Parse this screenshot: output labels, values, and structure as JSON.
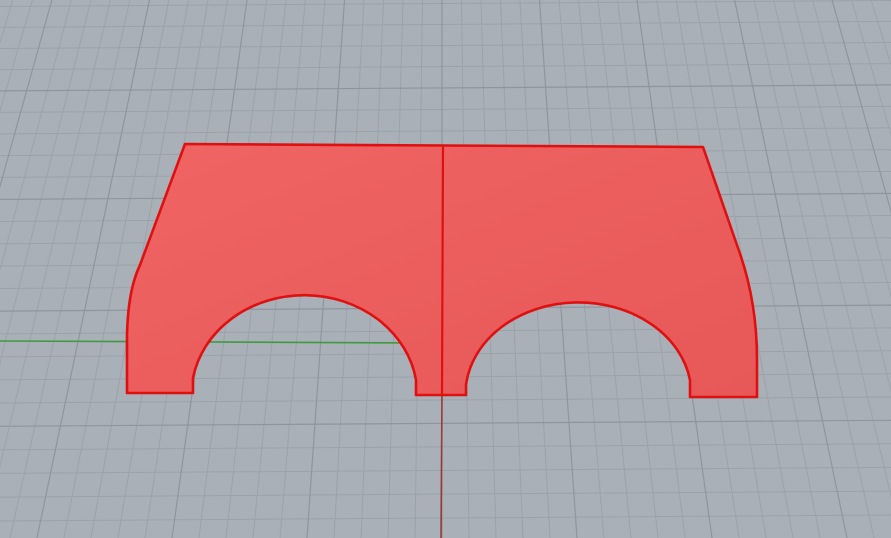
{
  "viewport": {
    "view_type": "perspective",
    "background_color": "#a9b0b8",
    "grid": {
      "visible": true,
      "minor_line_color": "#9ba2aa",
      "major_line_color": "#8e959d"
    },
    "axes": {
      "x_axis_color": "#3f9a3f",
      "y_axis_color": "#9a3a3a"
    }
  },
  "selected_object": {
    "type": "planar-surface",
    "selected": true,
    "fill_color": "#ee5a5a",
    "edge_color": "#e01010"
  }
}
